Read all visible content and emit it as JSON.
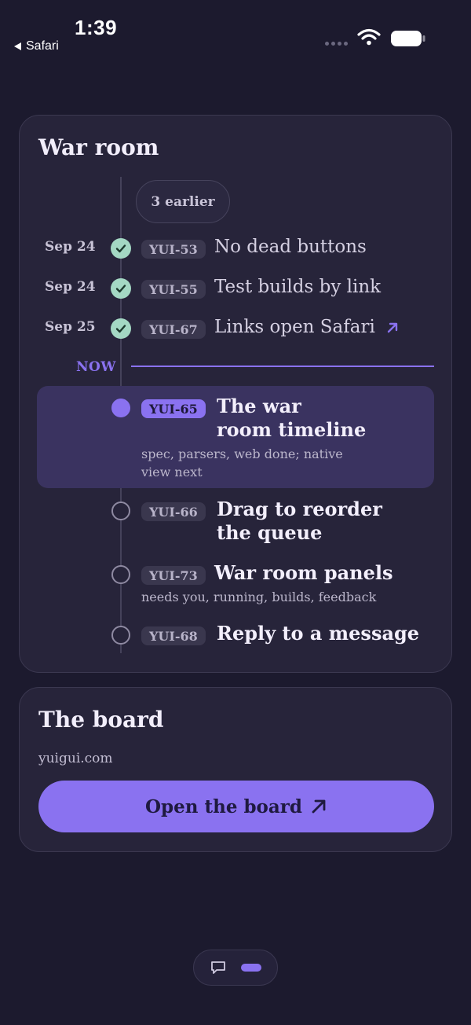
{
  "status_bar": {
    "time": "1:39",
    "back_label": "Safari"
  },
  "war_room": {
    "title": "War room",
    "earlier_label": "3 earlier",
    "done_items": [
      {
        "date": "Sep 24",
        "tag": "YUI-53",
        "text": "No dead buttons",
        "external": false
      },
      {
        "date": "Sep 24",
        "tag": "YUI-55",
        "text": "Test builds by link",
        "external": false
      },
      {
        "date": "Sep 25",
        "tag": "YUI-67",
        "text": "Links open Safari",
        "external": true
      }
    ],
    "now_label": "NOW",
    "active_item": {
      "tag": "YUI-65",
      "title_line1": "The war",
      "title_line2": "room timeline",
      "sub_line1": "spec, parsers, web done; native",
      "sub_line2": "view next"
    },
    "upcoming_items": [
      {
        "tag": "YUI-66",
        "title_line1": "Drag to reorder",
        "title_line2": "the queue",
        "sub": ""
      },
      {
        "tag": "YUI-73",
        "title_line1": "War room panels",
        "title_line2": "",
        "sub": "needs you, running, builds, feedback"
      },
      {
        "tag": "YUI-68",
        "title_line1": "Reply to a message",
        "title_line2": "",
        "sub": ""
      }
    ]
  },
  "board": {
    "title": "The board",
    "domain": "yuigui.com",
    "button_label": "Open the board"
  },
  "colors": {
    "background": "#1c1a2e",
    "card": "#27243a",
    "accent": "#8a72f0",
    "done_green": "#a4d8c4"
  }
}
